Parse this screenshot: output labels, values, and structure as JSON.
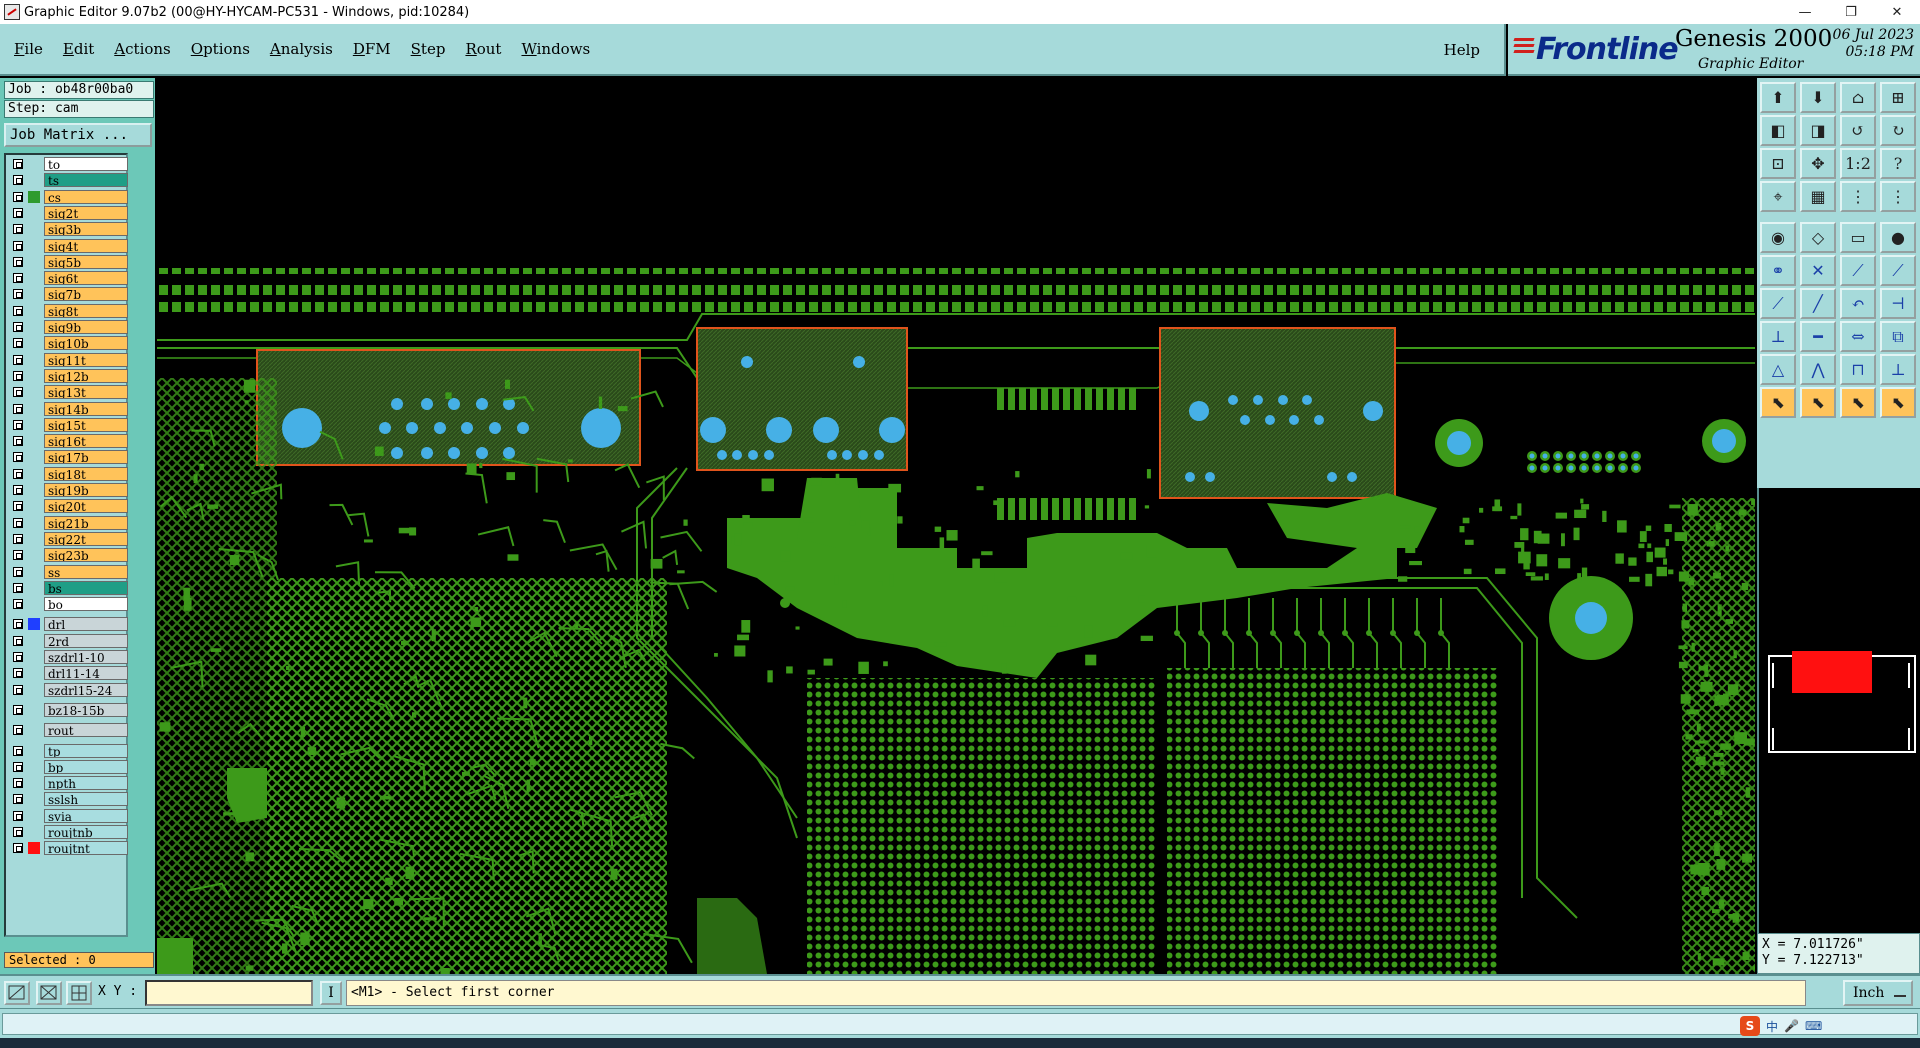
{
  "window": {
    "title": "Graphic Editor 9.07b2 (00@HY-HYCAM-PC531 - Windows, pid:10284)",
    "minimize_glyph": "—",
    "restore_glyph": "❐",
    "close_glyph": "✕"
  },
  "menu": {
    "items": [
      {
        "label": "File",
        "ul": "F",
        "rest": "ile"
      },
      {
        "label": "Edit",
        "ul": "E",
        "rest": "dit"
      },
      {
        "label": "Actions",
        "ul": "A",
        "rest": "ctions"
      },
      {
        "label": "Options",
        "ul": "O",
        "rest": "ptions"
      },
      {
        "label": "Analysis",
        "ul": "A",
        "rest": "nalysis"
      },
      {
        "label": "DFM",
        "ul": "D",
        "rest": "FM"
      },
      {
        "label": "Step",
        "ul": "S",
        "rest": "tep"
      },
      {
        "label": "Rout",
        "ul": "R",
        "rest": "out"
      },
      {
        "label": "Windows",
        "ul": "W",
        "rest": "indows"
      }
    ],
    "help": "Help"
  },
  "brand": {
    "logo": "Frontline",
    "product": "Genesis 2000",
    "subtitle": "Graphic Editor",
    "date": "06 Jul 2023",
    "time": "05:18 PM"
  },
  "job": {
    "job_line": "Job : ob48r00ba0",
    "step_line": "Step: cam",
    "matrix_button": "Job Matrix ..."
  },
  "layers": [
    {
      "name": "to",
      "color": "white",
      "swatch": ""
    },
    {
      "name": "ts",
      "color": "green",
      "swatch": ""
    },
    {
      "name": "cs",
      "color": "yellow",
      "swatch": "#2e9b2e"
    },
    {
      "name": "sig2t",
      "color": "yellow",
      "swatch": ""
    },
    {
      "name": "sig3b",
      "color": "yellow",
      "swatch": ""
    },
    {
      "name": "sig4t",
      "color": "yellow",
      "swatch": ""
    },
    {
      "name": "sig5b",
      "color": "yellow",
      "swatch": ""
    },
    {
      "name": "sig6t",
      "color": "yellow",
      "swatch": ""
    },
    {
      "name": "sig7b",
      "color": "yellow",
      "swatch": ""
    },
    {
      "name": "sig8t",
      "color": "yellow",
      "swatch": ""
    },
    {
      "name": "sig9b",
      "color": "yellow",
      "swatch": ""
    },
    {
      "name": "sig10b",
      "color": "yellow",
      "swatch": ""
    },
    {
      "name": "sig11t",
      "color": "yellow",
      "swatch": ""
    },
    {
      "name": "sig12b",
      "color": "yellow",
      "swatch": ""
    },
    {
      "name": "sig13t",
      "color": "yellow",
      "swatch": ""
    },
    {
      "name": "sig14b",
      "color": "yellow",
      "swatch": ""
    },
    {
      "name": "sig15t",
      "color": "yellow",
      "swatch": ""
    },
    {
      "name": "sig16t",
      "color": "yellow",
      "swatch": ""
    },
    {
      "name": "sig17b",
      "color": "yellow",
      "swatch": ""
    },
    {
      "name": "sig18t",
      "color": "yellow",
      "swatch": ""
    },
    {
      "name": "sig19b",
      "color": "yellow",
      "swatch": ""
    },
    {
      "name": "sig20t",
      "color": "yellow",
      "swatch": ""
    },
    {
      "name": "sig21b",
      "color": "yellow",
      "swatch": ""
    },
    {
      "name": "sig22t",
      "color": "yellow",
      "swatch": ""
    },
    {
      "name": "sig23b",
      "color": "yellow",
      "swatch": ""
    },
    {
      "name": "ss",
      "color": "yellow",
      "swatch": ""
    },
    {
      "name": "bs",
      "color": "green",
      "swatch": ""
    },
    {
      "name": "bo",
      "color": "white",
      "swatch": ""
    },
    {
      "name": "drl",
      "color": "grey",
      "swatch": "#1f3fff",
      "gap": true
    },
    {
      "name": "2rd",
      "color": "grey",
      "swatch": ""
    },
    {
      "name": "szdrl1-10",
      "color": "grey",
      "swatch": ""
    },
    {
      "name": "drl11-14",
      "color": "grey",
      "swatch": ""
    },
    {
      "name": "szdrl15-24",
      "color": "grey",
      "swatch": ""
    },
    {
      "name": "bz18-15b",
      "color": "grey",
      "swatch": "",
      "gap": true
    },
    {
      "name": "rout",
      "color": "grey",
      "swatch": "",
      "gap": true
    },
    {
      "name": "tp",
      "color": "cyan",
      "swatch": "",
      "gap": true
    },
    {
      "name": "bp",
      "color": "cyan",
      "swatch": ""
    },
    {
      "name": "npth",
      "color": "cyan",
      "swatch": ""
    },
    {
      "name": "sslsh",
      "color": "cyan",
      "swatch": ""
    },
    {
      "name": "svia",
      "color": "cyan",
      "swatch": ""
    },
    {
      "name": "roujtnb",
      "color": "cyan",
      "swatch": ""
    },
    {
      "name": "roujtnt",
      "color": "cyan",
      "swatch": "#ff1010"
    }
  ],
  "selected": "Selected : 0",
  "status": {
    "xy_label": "X Y :",
    "xy_value": "",
    "mode_glyph": "I",
    "prompt": "<M1> - Select first corner",
    "unit": "Inch"
  },
  "coords": {
    "x": "X = 7.011726\"",
    "y": "Y = 7.122713\""
  },
  "tray": {
    "ime": "S",
    "lang": "中"
  },
  "colors": {
    "copper": "#3d9a1a",
    "copper_dark": "#2a6a12",
    "drill": "#46b0e6",
    "highlight": "#e0541c",
    "panel": "#a6dada"
  }
}
